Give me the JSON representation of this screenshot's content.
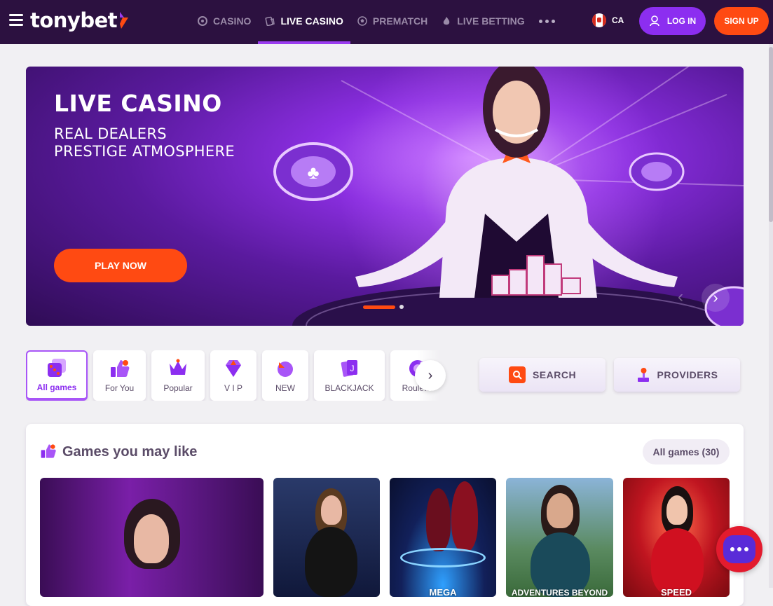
{
  "header": {
    "logo_text": "tonybet",
    "nav": [
      {
        "label": "CASINO",
        "icon": "casino-chip-icon",
        "active": false
      },
      {
        "label": "LIVE CASINO",
        "icon": "live-cards-icon",
        "active": true
      },
      {
        "label": "PREMATCH",
        "icon": "soccer-ball-icon",
        "active": false
      },
      {
        "label": "LIVE BETTING",
        "icon": "flame-icon",
        "active": false
      }
    ],
    "locale": "CA",
    "login_label": "LOG IN",
    "signup_label": "SIGN UP"
  },
  "hero": {
    "title": "LIVE CASINO",
    "subtitle_line1": "REAL DEALERS",
    "subtitle_line2": "PRESTIGE ATMOSPHERE",
    "cta": "PLAY NOW",
    "slides_total": 2,
    "active_slide": 1
  },
  "categories": [
    {
      "label": "All games",
      "icon": "dice-icon",
      "active": true
    },
    {
      "label": "For You",
      "icon": "thumbs-up-icon",
      "active": false
    },
    {
      "label": "Popular",
      "icon": "crown-icon",
      "active": false
    },
    {
      "label": "V I P",
      "icon": "diamond-icon",
      "active": false
    },
    {
      "label": "NEW",
      "icon": "new-badge-icon",
      "active": false
    },
    {
      "label": "BLACKJACK",
      "icon": "cards-icon",
      "active": false
    },
    {
      "label": "Roulette",
      "icon": "roulette-icon",
      "active": false
    }
  ],
  "search_label": "SEARCH",
  "providers_label": "PROVIDERS",
  "games": {
    "title": "Games you may like",
    "all_games_label": "All games (30)",
    "tiles": [
      {
        "label": "",
        "bg": "#5a1780"
      },
      {
        "label": "",
        "bg": "#1d2a55"
      },
      {
        "label": "MEGA",
        "bg": "#12205a"
      },
      {
        "label": "ADVENTURES BEYOND",
        "bg": "#6fa0c8"
      },
      {
        "label": "SPEED",
        "bg": "#b3121c"
      }
    ]
  },
  "colors": {
    "accent_purple": "#8c2ef0",
    "accent_orange": "#ff4a12",
    "header_bg": "#2c1140"
  }
}
